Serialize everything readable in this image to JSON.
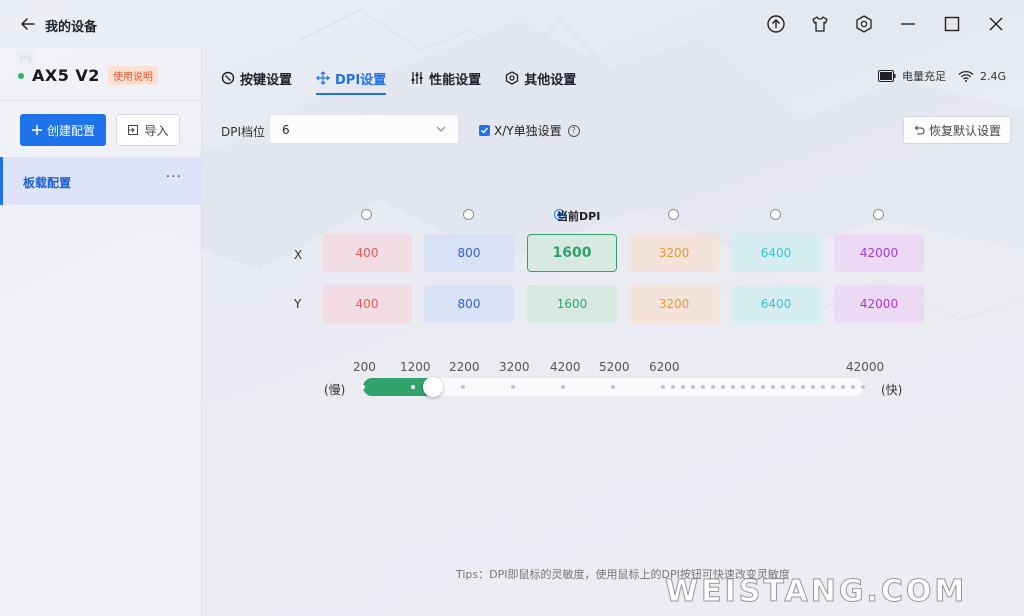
{
  "window": {
    "title": "我的设备"
  },
  "device": {
    "name": "AX5 V2",
    "manual_badge": "使用说明",
    "status_color": "#2fb16b"
  },
  "sidebar": {
    "create_label": "创建配置",
    "import_label": "导入",
    "profiles": [
      {
        "label": "板载配置",
        "more": "···"
      }
    ]
  },
  "tabs": [
    {
      "label": "按键设置",
      "icon": "key-settings-icon",
      "active": false
    },
    {
      "label": "DPI设置",
      "icon": "dpi-icon",
      "active": true
    },
    {
      "label": "性能设置",
      "icon": "sliders-icon",
      "active": false
    },
    {
      "label": "其他设置",
      "icon": "hexagon-gear-icon",
      "active": false
    }
  ],
  "status": {
    "battery": "电量充足",
    "wireless": "2.4G"
  },
  "dpi": {
    "level_label": "DPI档位",
    "level_value": "6",
    "xy_separate_label": "X/Y单独设置",
    "xy_separate_checked": true,
    "reset_label": "恢复默认设置",
    "current_label": "当前DPI",
    "current_index": 2,
    "axis_x": "X",
    "axis_y": "Y",
    "x_values": [
      "400",
      "800",
      "1600",
      "3200",
      "6400",
      "42000"
    ],
    "y_values": [
      "400",
      "800",
      "1600",
      "3200",
      "6400",
      "42000"
    ],
    "colors": [
      {
        "bg": "#f1dde3",
        "fg": "#e25a5a"
      },
      {
        "bg": "#d9e1f5",
        "fg": "#2f62d8"
      },
      {
        "bg": "#d8e9e2",
        "fg": "#2fa36a"
      },
      {
        "bg": "#f3e3da",
        "fg": "#f0962a"
      },
      {
        "bg": "#d6eef2",
        "fg": "#2fc7d0"
      },
      {
        "bg": "#ecd9f4",
        "fg": "#a43ad6"
      }
    ]
  },
  "slider": {
    "ticks": [
      "200",
      "1200",
      "2200",
      "3200",
      "4200",
      "5200",
      "6200",
      "42000"
    ],
    "slow": "(慢)",
    "fast": "(快)",
    "value": 1600,
    "min": 200,
    "max": 42000,
    "fill_color": "#2fa36a"
  },
  "tips": "Tips：DPI即鼠标的灵敏度，使用鼠标上的DPI按钮可快速改变灵敏度",
  "watermark": "WEISTANG.COM",
  "ps_badge": "PS"
}
